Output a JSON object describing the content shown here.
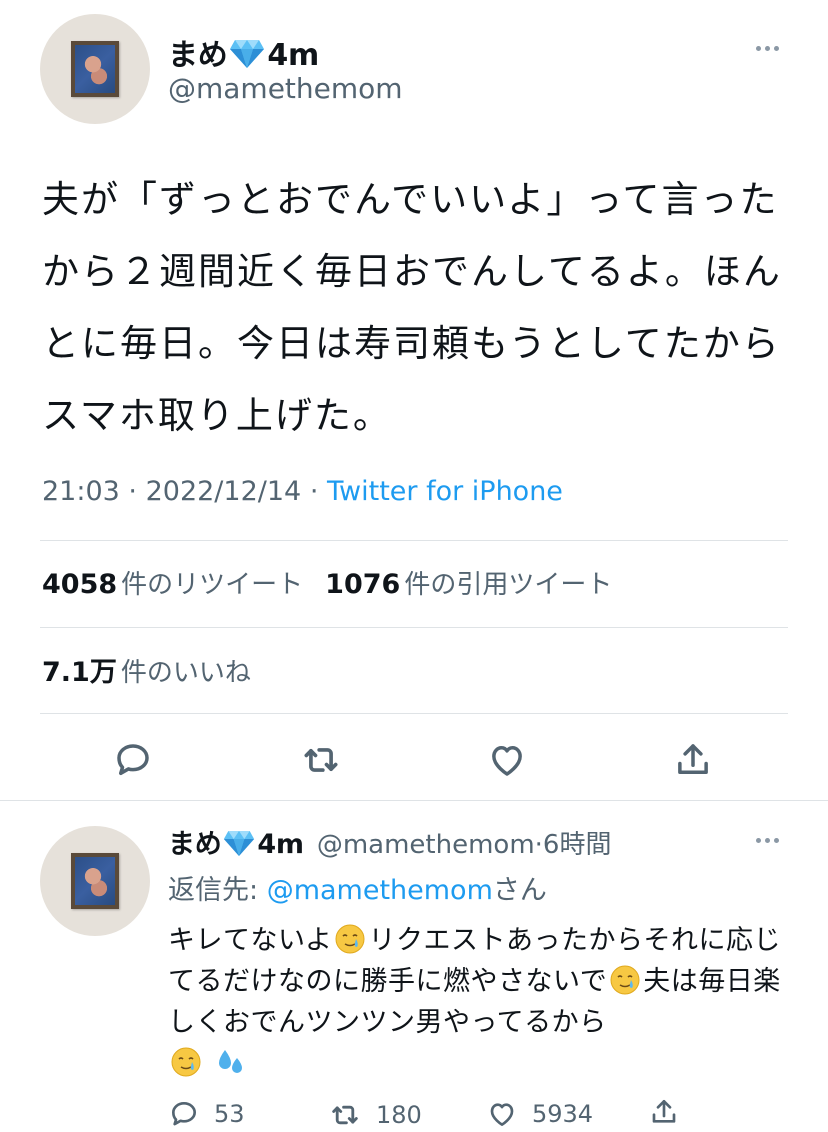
{
  "main_tweet": {
    "author_name": "まめ",
    "author_suffix": "4m",
    "author_handle": "@mamethemom",
    "text": "夫が「ずっとおでんでいいよ」って言ったから２週間近く毎日おでんしてるよ。ほんとに毎日。今日は寿司頼もうとしてたからスマホ取り上げた。",
    "time": "21:03",
    "date": "2022/12/14",
    "source": "Twitter for iPhone",
    "separator": "·"
  },
  "stats": {
    "retweets_num": "4058",
    "retweets_label": "件のリツイート",
    "quotes_num": "1076",
    "quotes_label": "件の引用ツイート",
    "likes_num": "7.1万",
    "likes_label": "件のいいね"
  },
  "reply_tweet": {
    "author_name": "まめ",
    "author_suffix": "4m",
    "author_handle": "@mamethemom",
    "separator": "·",
    "time_ago": "6時間",
    "reply_prefix": "返信先: ",
    "reply_to": "@mamethemom",
    "reply_suffix": "さん",
    "text_part1": "キレてないよ",
    "text_part2": "リクエストあったからそれに応じてるだけなのに勝手に燃やさないで",
    "text_part3": "夫は毎日楽しくおでんツンツン男やってるから",
    "reply_count": "53",
    "retweet_count": "180",
    "like_count": "5934"
  },
  "colors": {
    "accent": "#1d9bf0",
    "secondary_text": "#536471",
    "primary_text": "#0f1419",
    "divider": "#dfe3e6"
  },
  "icons": [
    "diamond-emoji",
    "more-icon",
    "reply-icon",
    "retweet-icon",
    "like-icon",
    "share-icon",
    "tear-smile-emoji",
    "sweat-drops-emoji"
  ]
}
